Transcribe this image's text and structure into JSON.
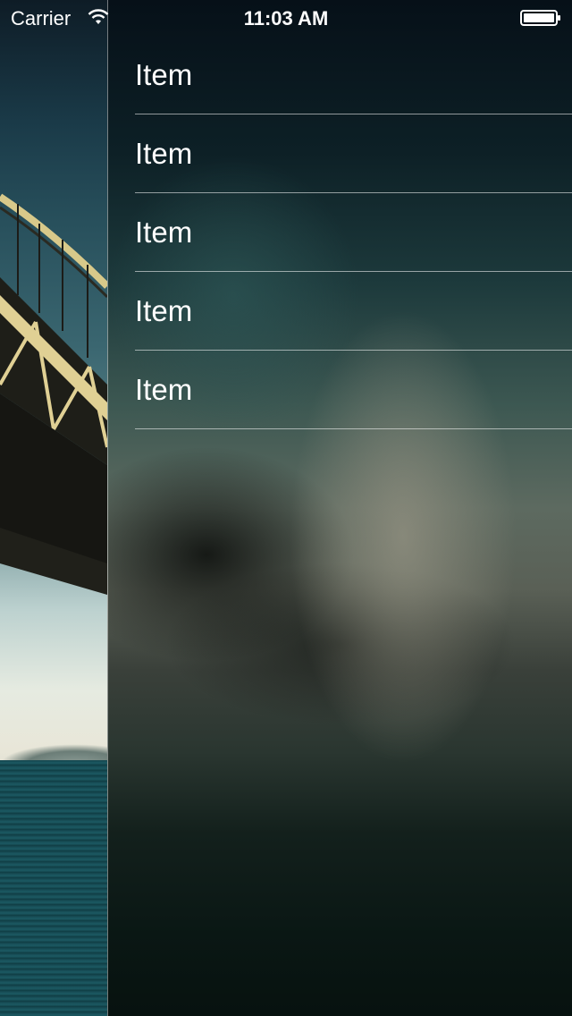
{
  "status_bar": {
    "carrier": "Carrier",
    "time": "11:03 AM",
    "icons": [
      "wifi-icon",
      "battery-icon"
    ]
  },
  "menu": {
    "items": [
      {
        "label": "Item"
      },
      {
        "label": "Item"
      },
      {
        "label": "Item"
      },
      {
        "label": "Item"
      },
      {
        "label": "Item"
      }
    ]
  },
  "colors": {
    "text": "#ffffff",
    "separator": "#d0d6d6"
  }
}
